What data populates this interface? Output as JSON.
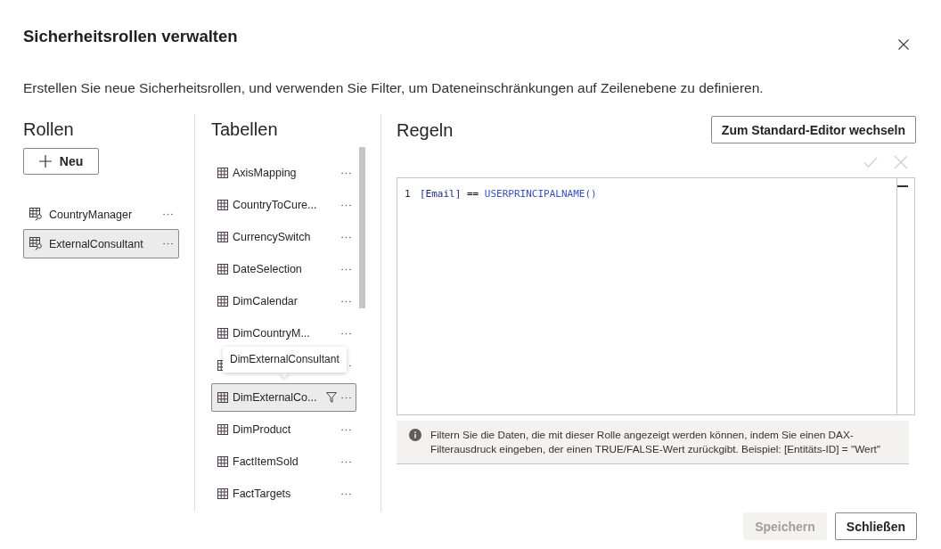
{
  "dialog": {
    "title": "Sicherheitsrollen verwalten",
    "description": "Erstellen Sie neue Sicherheitsrollen, und verwenden Sie Filter, um Dateneinschränkungen auf Zeilenebene zu definieren."
  },
  "roles": {
    "heading": "Rollen",
    "new_button": "Neu",
    "items": [
      {
        "name": "CountryManager",
        "selected": false
      },
      {
        "name": "ExternalConsultant",
        "selected": true
      }
    ]
  },
  "tables": {
    "heading": "Tabellen",
    "tooltip": "DimExternalConsultant",
    "items": [
      {
        "name": "AxisMapping",
        "selected": false,
        "filtered": false
      },
      {
        "name": "CountryToCure...",
        "selected": false,
        "filtered": false
      },
      {
        "name": "CurrencySwitch",
        "selected": false,
        "filtered": false
      },
      {
        "name": "DateSelection",
        "selected": false,
        "filtered": false
      },
      {
        "name": "DimCalendar",
        "selected": false,
        "filtered": false
      },
      {
        "name": "DimCountryM...",
        "selected": false,
        "filtered": false
      },
      {
        "selected": false,
        "filtered": false
      },
      {
        "name": "DimExternalCo...",
        "selected": true,
        "filtered": true
      },
      {
        "name": "DimProduct",
        "selected": false,
        "filtered": false
      },
      {
        "name": "FactItemSold",
        "selected": false,
        "filtered": false
      },
      {
        "name": "FactTargets",
        "selected": false,
        "filtered": false
      }
    ]
  },
  "rules": {
    "heading": "Regeln",
    "switch_button": "Zum Standard-Editor wechseln",
    "actions_disabled": true,
    "editor": {
      "lines": [
        {
          "number": "1",
          "tokens": [
            {
              "kind": "column",
              "text": "[Email]"
            },
            {
              "kind": "operator",
              "text": "=="
            },
            {
              "kind": "function",
              "text": "USERPRINCIPALNAME()"
            }
          ]
        }
      ]
    },
    "info": "Filtern Sie die Daten, die mit dieser Rolle angezeigt werden können, indem Sie einen DAX-Filterausdruck eingeben, der einen TRUE/FALSE-Wert zurückgibt. Beispiel: [Entitäts-ID] = \"Wert\""
  },
  "footer": {
    "buttons": [
      {
        "label": "Speichern",
        "disabled": true
      },
      {
        "label": "Schließen",
        "disabled": false
      }
    ]
  }
}
